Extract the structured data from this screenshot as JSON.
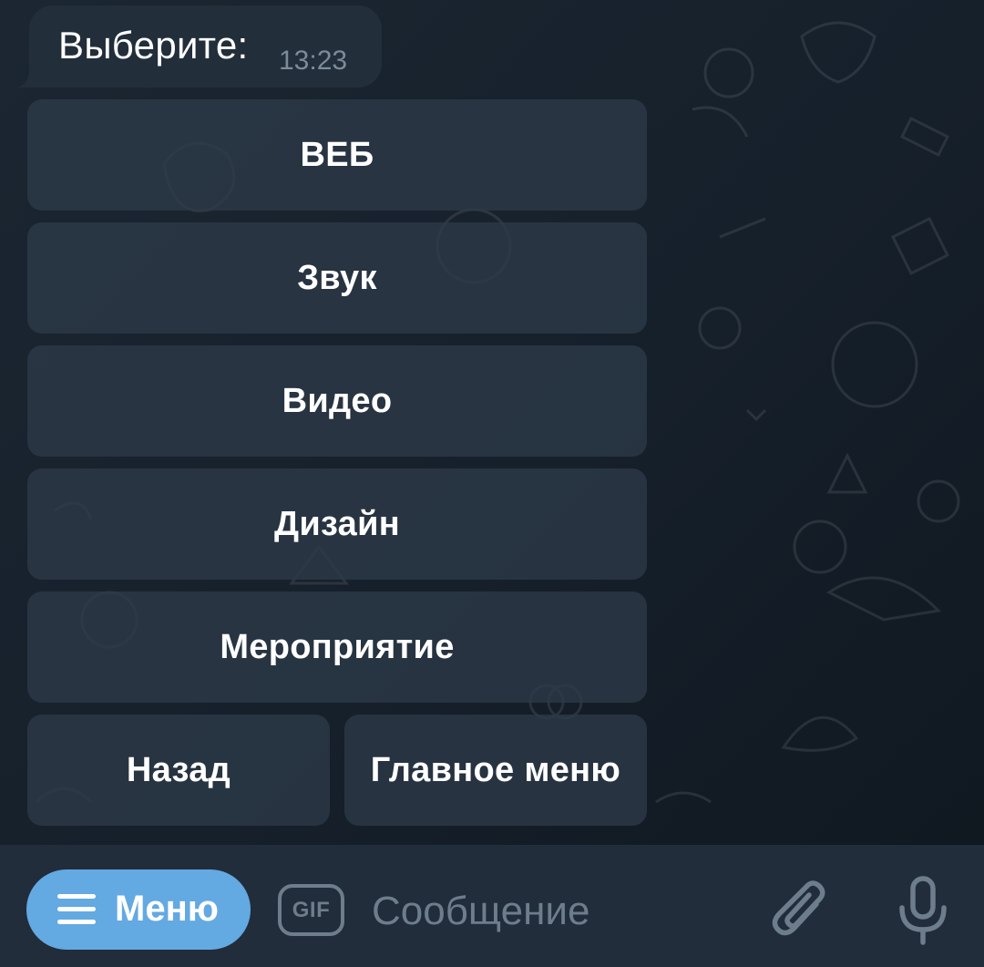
{
  "message": {
    "text": "Выберите:",
    "time": "13:23"
  },
  "keyboard": {
    "buttons": [
      {
        "label": "ВЕБ"
      },
      {
        "label": "Звук"
      },
      {
        "label": "Видео"
      },
      {
        "label": "Дизайн"
      },
      {
        "label": "Мероприятие"
      }
    ],
    "back_label": "Назад",
    "main_menu_label": "Главное меню"
  },
  "bottom_bar": {
    "menu_label": "Меню",
    "gif_label": "GIF",
    "input_placeholder": "Сообщение",
    "input_value": ""
  },
  "colors": {
    "chat_background": "#17212b",
    "bubble": "#222e3a",
    "keyboard_button": "#2d3a48",
    "bottom_bar": "#212d3b",
    "menu_button": "#63a9e2",
    "muted_icon": "#6d7d8c",
    "timestamp": "#7b8b9a"
  },
  "icons": {
    "menu": "hamburger-icon",
    "gif": "gif-icon",
    "attach": "paperclip-icon",
    "mic": "microphone-icon"
  }
}
